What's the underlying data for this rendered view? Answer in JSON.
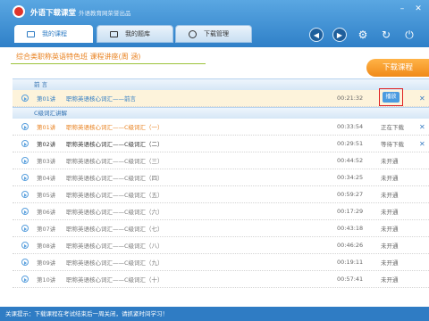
{
  "app": {
    "title": "外语下载课堂",
    "subtitle": "外语教育网荣誉出品"
  },
  "tabs": [
    {
      "label": "我的课程",
      "icon": "monitor-icon"
    },
    {
      "label": "我的题库",
      "icon": "book-icon"
    },
    {
      "label": "下载管理",
      "icon": "download-icon"
    }
  ],
  "course": {
    "title": "综合类职称英语特色班 课程讲座(周 涵)",
    "download_button": "下载课程"
  },
  "sections": [
    {
      "label": "前 言"
    },
    {
      "label": "C级词汇讲解"
    }
  ],
  "rows": [
    {
      "num": "第01讲",
      "title": "职称英语核心词汇——前言",
      "duration": "00:21:32",
      "status": "播放",
      "state": "playing"
    },
    {
      "num": "第01讲",
      "title": "职称英语核心词汇——C级词汇（一）",
      "duration": "00:33:54",
      "status": "正在下载",
      "state": "downloading"
    },
    {
      "num": "第02讲",
      "title": "职称英语核心词汇——C级词汇（二）",
      "duration": "00:29:51",
      "status": "等待下载",
      "state": "waiting"
    },
    {
      "num": "第03讲",
      "title": "职称英语核心词汇——C级词汇（三）",
      "duration": "00:44:52",
      "status": "未开通",
      "state": "locked"
    },
    {
      "num": "第04讲",
      "title": "职称英语核心词汇——C级词汇（四）",
      "duration": "00:34:25",
      "status": "未开通",
      "state": "locked"
    },
    {
      "num": "第05讲",
      "title": "职称英语核心词汇——C级词汇（五）",
      "duration": "00:59:27",
      "status": "未开通",
      "state": "locked"
    },
    {
      "num": "第06讲",
      "title": "职称英语核心词汇——C级词汇（六）",
      "duration": "00:17:29",
      "status": "未开通",
      "state": "locked"
    },
    {
      "num": "第07讲",
      "title": "职称英语核心词汇——C级词汇（七）",
      "duration": "00:43:18",
      "status": "未开通",
      "state": "locked"
    },
    {
      "num": "第08讲",
      "title": "职称英语核心词汇——C级词汇（八）",
      "duration": "00:46:26",
      "status": "未开通",
      "state": "locked"
    },
    {
      "num": "第09讲",
      "title": "职称英语核心词汇——C级词汇（九）",
      "duration": "00:19:11",
      "status": "未开通",
      "state": "locked"
    },
    {
      "num": "第10讲",
      "title": "职称英语核心词汇——C级词汇（十）",
      "duration": "00:57:41",
      "status": "未开通",
      "state": "locked"
    }
  ],
  "footer": {
    "text": "关课提示：下载课程在考试结束后一周关闭，请抓紧时间学习！"
  }
}
